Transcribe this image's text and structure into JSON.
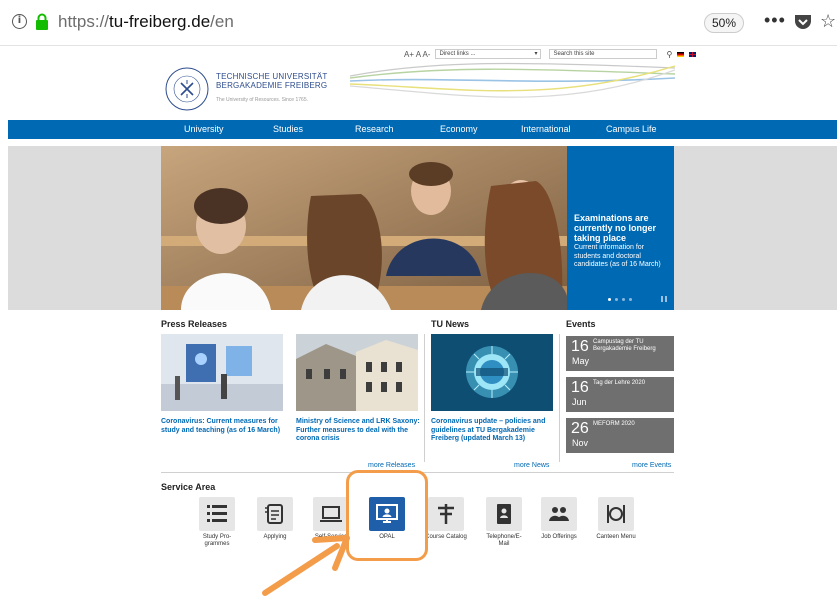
{
  "browser": {
    "url_scheme": "https://",
    "url_host": "tu-freiberg.de",
    "url_path": "/en",
    "zoom": "50%",
    "menu_glyph": "•••",
    "star_glyph": "☆"
  },
  "header": {
    "font_size_controls": "A+ A A-",
    "direct_links_label": "Direct links ...",
    "search_placeholder": "Search this site",
    "uni_name_line1": "TECHNISCHE UNIVERSITÄT",
    "uni_name_line2": "BERGAKADEMIE FREIBERG",
    "uni_tagline": "The University of Resources. Since 1765."
  },
  "nav": [
    "University",
    "Studies",
    "Research",
    "Economy",
    "International",
    "Campus Life"
  ],
  "hero": {
    "headline": "Examinations are currently no longer taking place",
    "text": "Current information for students and doctoral candidates (as of 16 March)"
  },
  "sections": {
    "press": "Press Releases",
    "tunews": "TU News",
    "events": "Events",
    "service": "Service Area"
  },
  "press": [
    {
      "title": "Coronavirus: Current measures for study and teaching (as of 16 March)"
    },
    {
      "title": "Ministry of Science and LRK Saxony: Further measures to deal with the corona crisis"
    }
  ],
  "tunews": [
    {
      "title": "Coronavirus update – policies and guidelines at TU Bergakademie Freiberg (updated March 13)"
    }
  ],
  "events": [
    {
      "day": "16",
      "month": "May",
      "title": "Campustag der TU Bergakademie Freiberg"
    },
    {
      "day": "16",
      "month": "Jun",
      "title": "Tag der Lehre 2020"
    },
    {
      "day": "26",
      "month": "Nov",
      "title": "MEFORM 2020"
    }
  ],
  "more": {
    "releases": "more Releases",
    "news": "more News",
    "events": "more Events"
  },
  "services": [
    {
      "label": "Study Pro-\ngrammes",
      "icon": "list-icon"
    },
    {
      "label": "Applying",
      "icon": "form-icon"
    },
    {
      "label": "Self-Service",
      "icon": "laptop-icon"
    },
    {
      "label": "OPAL",
      "icon": "monitor-user-icon"
    },
    {
      "label": "Course Catalog",
      "icon": "signpost-icon"
    },
    {
      "label": "Telephone/E-\nMail",
      "icon": "phonebook-icon"
    },
    {
      "label": "Job Offerings",
      "icon": "people-icon"
    },
    {
      "label": "Canteen Menu",
      "icon": "cutlery-icon"
    }
  ],
  "colors": {
    "brand_blue": "#0069b4",
    "highlight_orange": "#f39c4a"
  }
}
